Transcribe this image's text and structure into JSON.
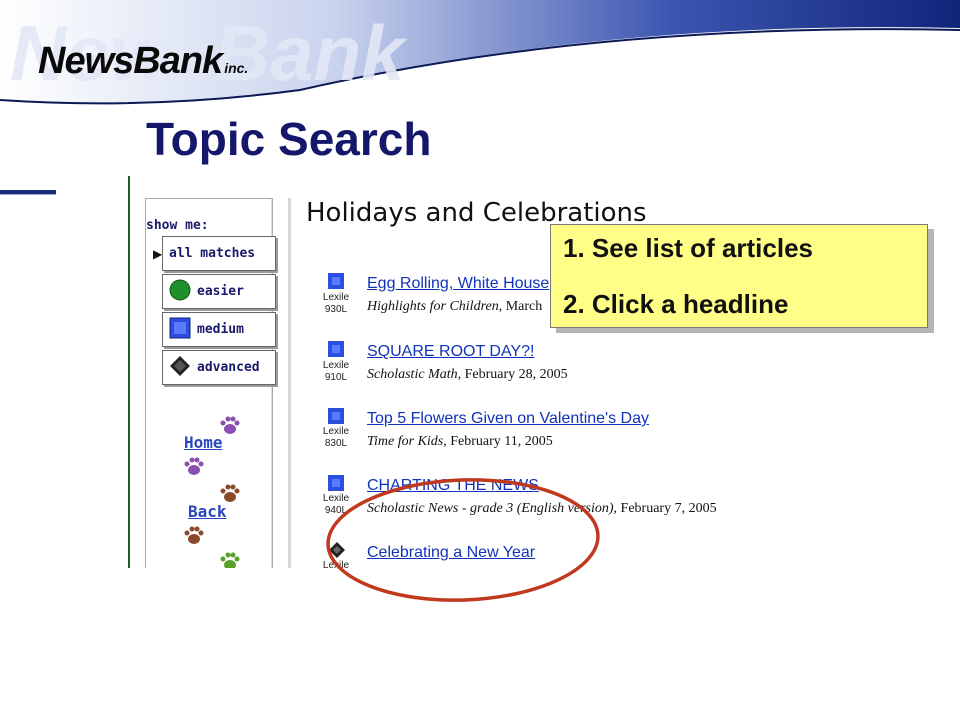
{
  "header": {
    "logo": "NewsBank",
    "logo_suffix": "inc."
  },
  "title": "Topic Search",
  "sidebar": {
    "show_me_label": "show me:",
    "filters": [
      {
        "label": "all matches",
        "selected": true
      },
      {
        "label": "easier",
        "icon": "green-circle-icon"
      },
      {
        "label": "medium",
        "icon": "blue-square-icon"
      },
      {
        "label": "advanced",
        "icon": "black-diamond-icon"
      }
    ],
    "nav": {
      "home": "Home",
      "back": "Back"
    }
  },
  "section_title": "Holidays and Celebrations",
  "articles": [
    {
      "headline": "Egg Rolling, White House",
      "publication": "Highlights for Children",
      "date": ", March",
      "lexile_label": "Lexile",
      "lexile": "930L",
      "level": "medium"
    },
    {
      "headline": "SQUARE ROOT DAY?!",
      "publication": "Scholastic Math",
      "date": ", February 28, 2005",
      "lexile_label": "Lexile",
      "lexile": "910L",
      "level": "medium"
    },
    {
      "headline": "Top 5 Flowers Given on Valentine's Day",
      "publication": "Time for Kids",
      "date": ", February 11, 2005",
      "lexile_label": "Lexile",
      "lexile": "830L",
      "level": "medium"
    },
    {
      "headline": "CHARTING THE NEWS",
      "publication": "Scholastic News - grade 3 (English version)",
      "date": ", February 7, 2005",
      "lexile_label": "Lexile",
      "lexile": "940L",
      "level": "medium"
    },
    {
      "headline": "Celebrating a New Year",
      "publication": "",
      "date": "",
      "lexile_label": "Lexile",
      "lexile": "",
      "level": "advanced"
    }
  ],
  "callout": {
    "step1": "1.  See list of articles",
    "step2": "2.  Click a headline"
  },
  "colors": {
    "title": "#15176a",
    "link": "#1133bb",
    "callout_bg": "#ffff88",
    "highlight_ellipse": "#c0391f"
  }
}
